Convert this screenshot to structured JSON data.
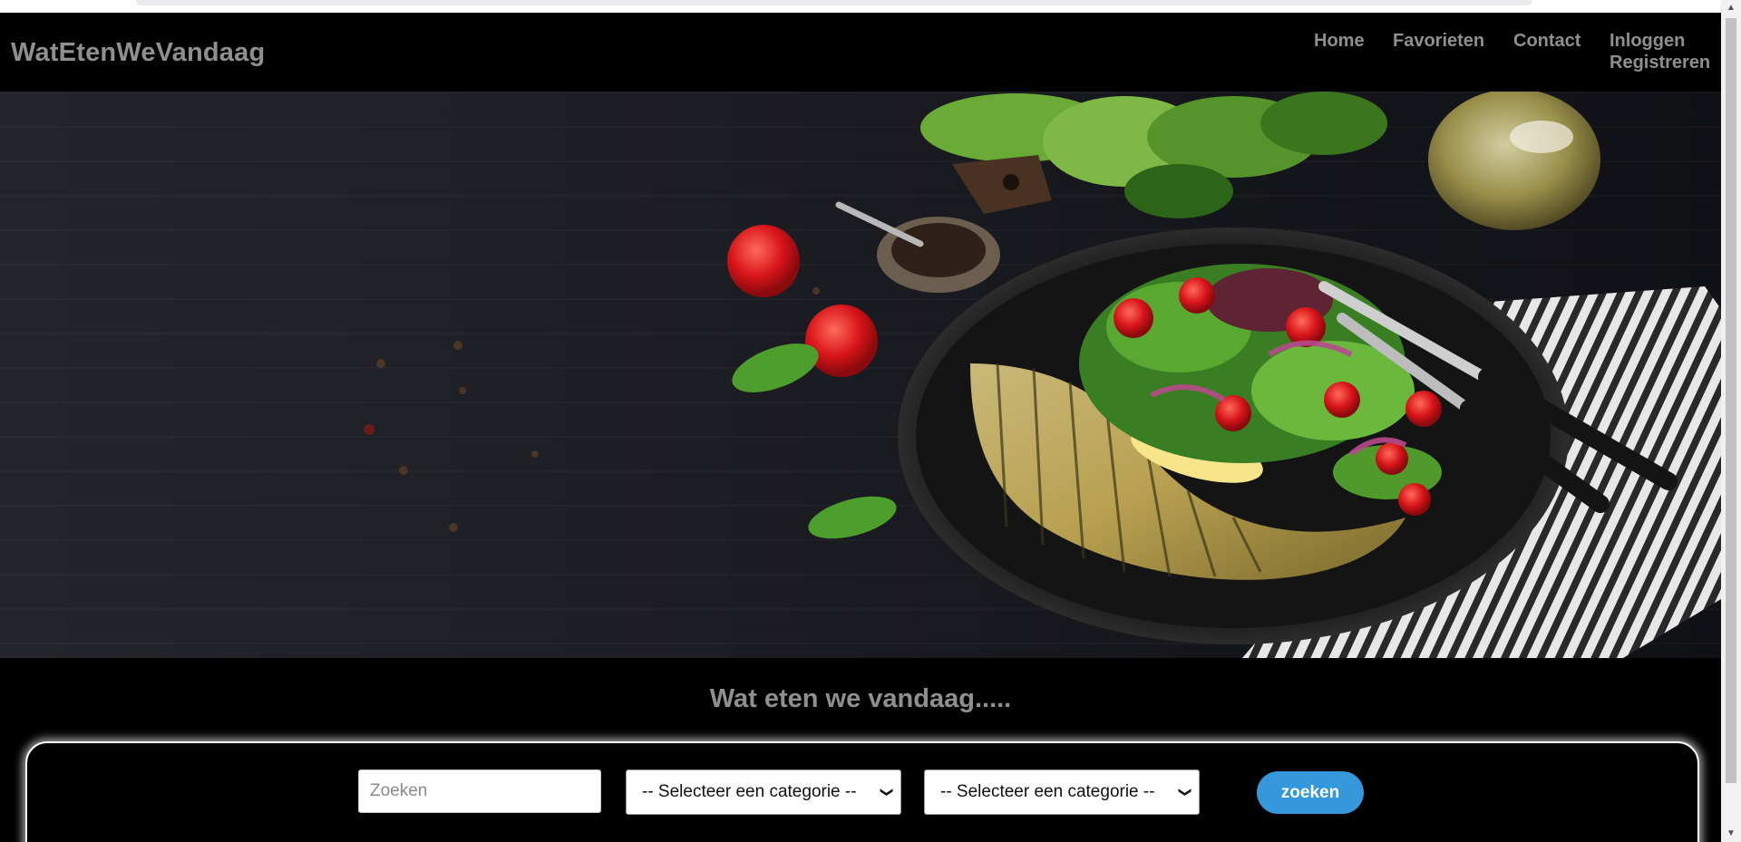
{
  "header": {
    "logo": "WatEtenWeVandaag",
    "nav": {
      "home": "Home",
      "favorites": "Favorieten",
      "contact": "Contact",
      "login": "Inloggen",
      "register": "Registreren"
    }
  },
  "hero": {
    "image": "salad-plate-with-mackerel-on-dark-wood"
  },
  "main": {
    "headline": "Wat eten we vandaag....."
  },
  "search": {
    "placeholder": "Zoeken",
    "category_1": "-- Selecteer een categorie --",
    "category_2": "-- Selecteer een categorie --",
    "button_label": "zoeken",
    "button_color": "#3498db"
  },
  "icons": {
    "select_chevron": "chevron-down-icon",
    "scroll_up": "scroll-up-arrow-icon",
    "scroll_down": "scroll-down-arrow-icon"
  }
}
